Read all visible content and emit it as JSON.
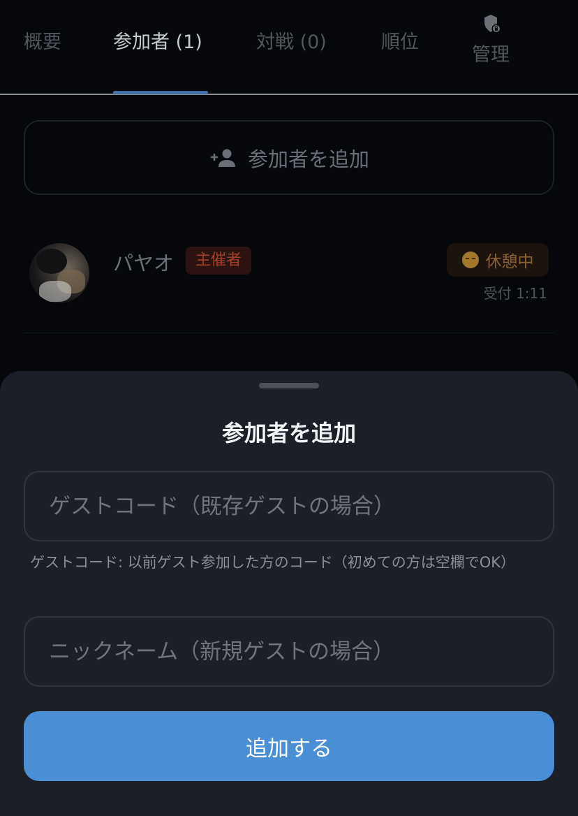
{
  "tabs": {
    "overview": "概要",
    "participants": "参加者 (1)",
    "matches": "対戦 (0)",
    "ranking": "順位",
    "admin": "管理"
  },
  "add_participant_button": {
    "label": "参加者を追加",
    "icon": "person-add-icon"
  },
  "participants": [
    {
      "name": "パヤオ",
      "role_badge": "主催者",
      "status": "休憩中",
      "status_icon": "sleeping-face-icon",
      "received": "受付 1:11"
    }
  ],
  "sheet": {
    "title": "参加者を追加",
    "guest_code_placeholder": "ゲストコード（既存ゲストの場合）",
    "guest_code_help": "ゲストコード: 以前ゲスト参加した方のコード（初めての方は空欄でOK）",
    "nickname_placeholder": "ニックネーム（新規ゲストの場合）",
    "submit_label": "追加する"
  },
  "colors": {
    "accent": "#4a8fd6",
    "background": "#05070b",
    "sheet": "#1c1f27",
    "host_badge": "#a3402a",
    "status": "#8a6330"
  }
}
